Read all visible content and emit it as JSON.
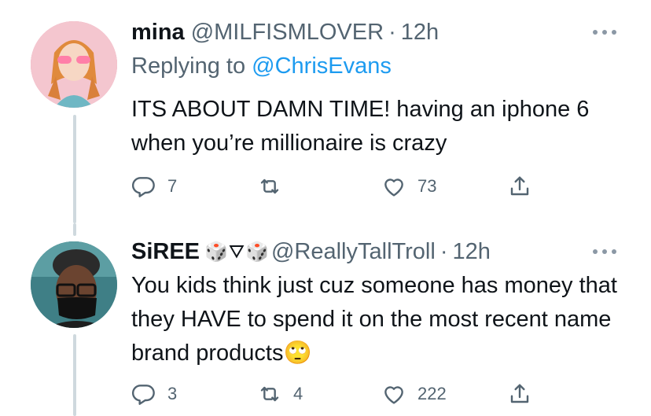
{
  "tweets": [
    {
      "display_name": "mina",
      "handle": "@MILFISMLOVER",
      "separator": "·",
      "time": "12h",
      "replying_prefix": "Replying to",
      "replying_to": "@ChrisEvans",
      "text": "ITS ABOUT DAMN TIME! having an iphone 6 when you’re millionaire is crazy",
      "replies": "7",
      "retweets": "",
      "likes": "73"
    },
    {
      "display_name": "SiREE",
      "name_emojis": "🎲⛛🎲",
      "handle": "@ReallyTallTroll",
      "separator": "·",
      "time": "12h",
      "text": "You kids think just cuz someone has money that they HAVE to spend it on the most recent name brand products🙄",
      "replies": "3",
      "retweets": "4",
      "likes": "222"
    }
  ],
  "icons": {
    "reply": "reply-icon",
    "retweet": "retweet-icon",
    "like": "heart-icon",
    "share": "share-icon",
    "more": "more-icon"
  },
  "colors": {
    "text": "#0f1419",
    "secondary": "#536471",
    "link": "#1d9bf0",
    "thread_line": "#cfd9de"
  }
}
